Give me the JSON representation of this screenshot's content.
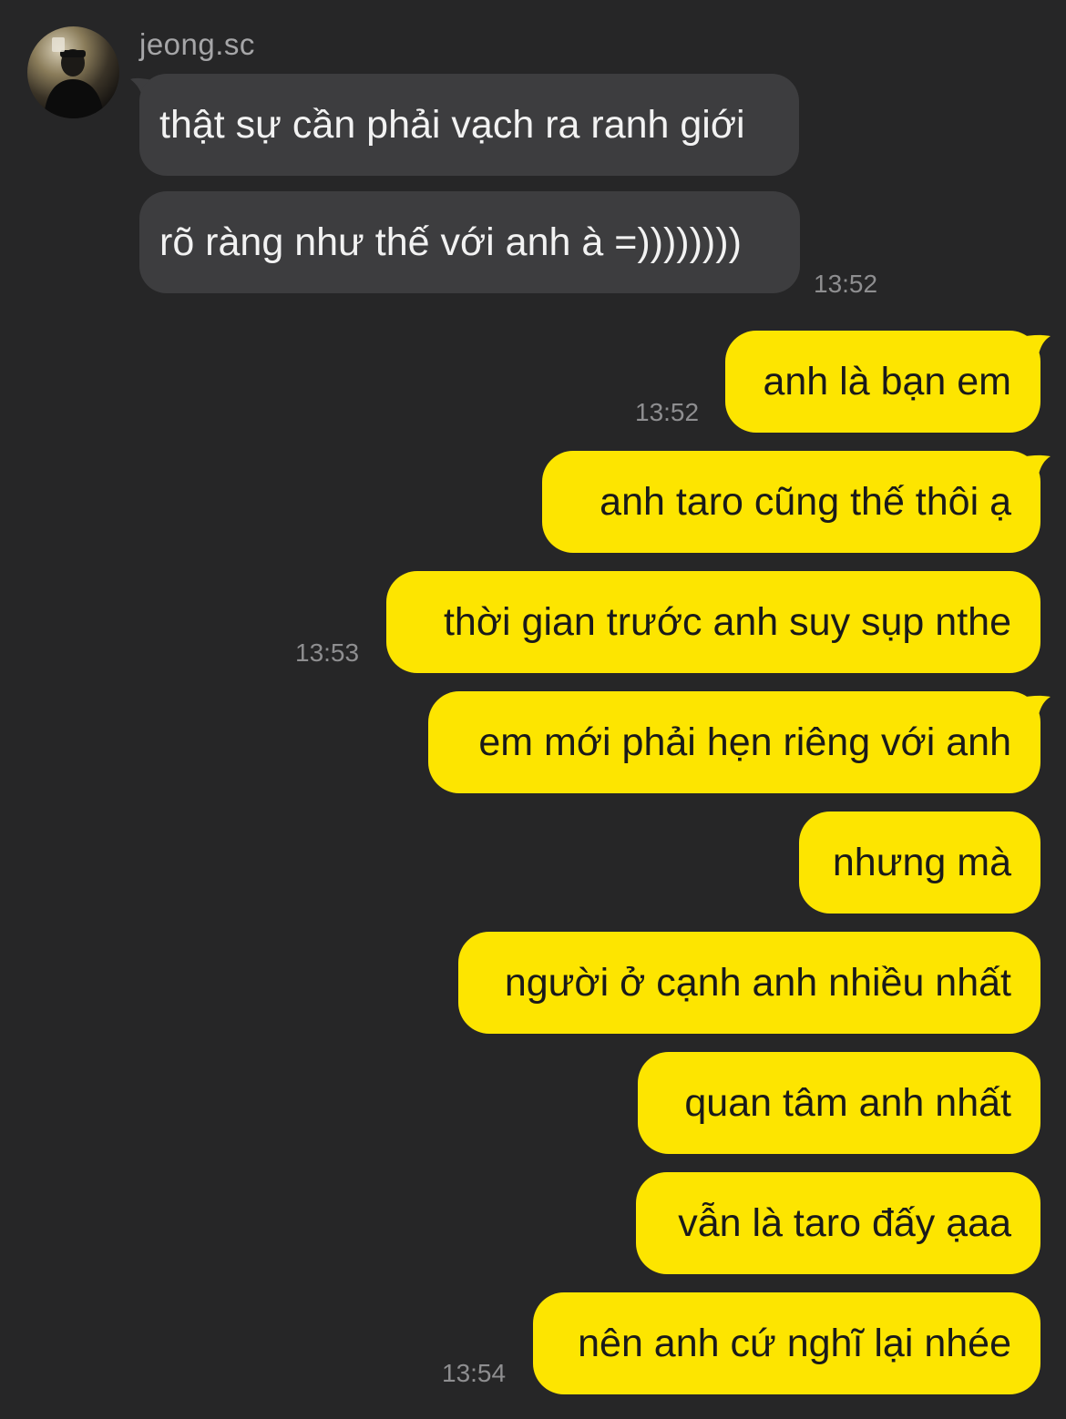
{
  "contact": {
    "name": "jeong.sc",
    "avatar_icon": "profile-photo"
  },
  "colors": {
    "background": "#262627",
    "incoming_bubble": "#3d3d3f",
    "outgoing_bubble": "#fde500",
    "timestamp": "#8e8e90"
  },
  "messages": {
    "incoming": [
      {
        "text": "thật sự cần phải vạch ra ranh giới"
      },
      {
        "text": "rõ ràng như thế với anh à =))))))))",
        "time": "13:52"
      }
    ],
    "outgoing": [
      {
        "text": "anh là bạn em",
        "time": "13:52"
      },
      {
        "text": "anh taro cũng thế thôi ạ"
      },
      {
        "text": "thời gian trước anh suy sụp nthe",
        "time": "13:53"
      },
      {
        "text": "em mới phải hẹn riêng với anh"
      },
      {
        "text": "nhưng mà"
      },
      {
        "text": "người ở cạnh anh nhiều nhất"
      },
      {
        "text": "quan tâm anh nhất"
      },
      {
        "text": "vẫn là taro đấy ạaa"
      },
      {
        "text": "nên anh cứ nghĩ lại nhée",
        "time": "13:54"
      }
    ]
  }
}
